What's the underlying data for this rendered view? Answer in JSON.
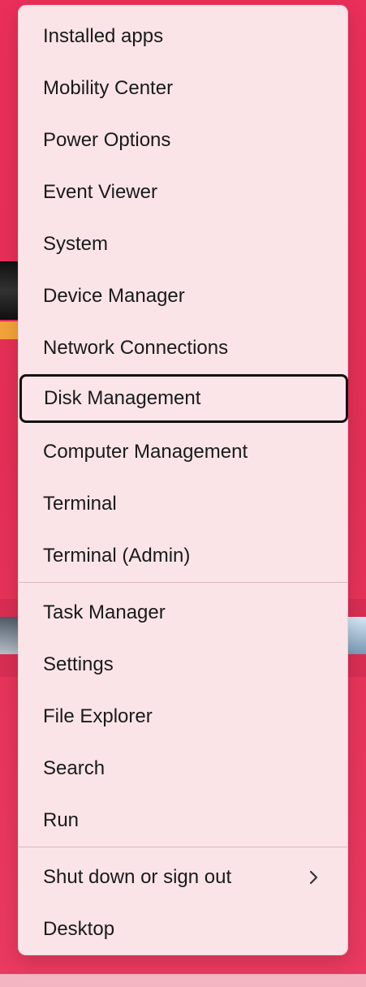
{
  "menu": {
    "items": [
      {
        "label": "Installed apps"
      },
      {
        "label": "Mobility Center"
      },
      {
        "label": "Power Options"
      },
      {
        "label": "Event Viewer"
      },
      {
        "label": "System"
      },
      {
        "label": "Device Manager"
      },
      {
        "label": "Network Connections"
      },
      {
        "label": "Disk Management"
      },
      {
        "label": "Computer Management"
      },
      {
        "label": "Terminal"
      },
      {
        "label": "Terminal (Admin)"
      },
      {
        "label": "Task Manager"
      },
      {
        "label": "Settings"
      },
      {
        "label": "File Explorer"
      },
      {
        "label": "Search"
      },
      {
        "label": "Run"
      },
      {
        "label": "Shut down or sign out"
      },
      {
        "label": "Desktop"
      }
    ],
    "focused_item": "Disk Management",
    "icons": {
      "submenu": "chevron-right-icon"
    },
    "colors": {
      "menu_background": "#fbe4e8",
      "desktop_accent": "#e8305a",
      "text": "#1a1a1a"
    }
  }
}
